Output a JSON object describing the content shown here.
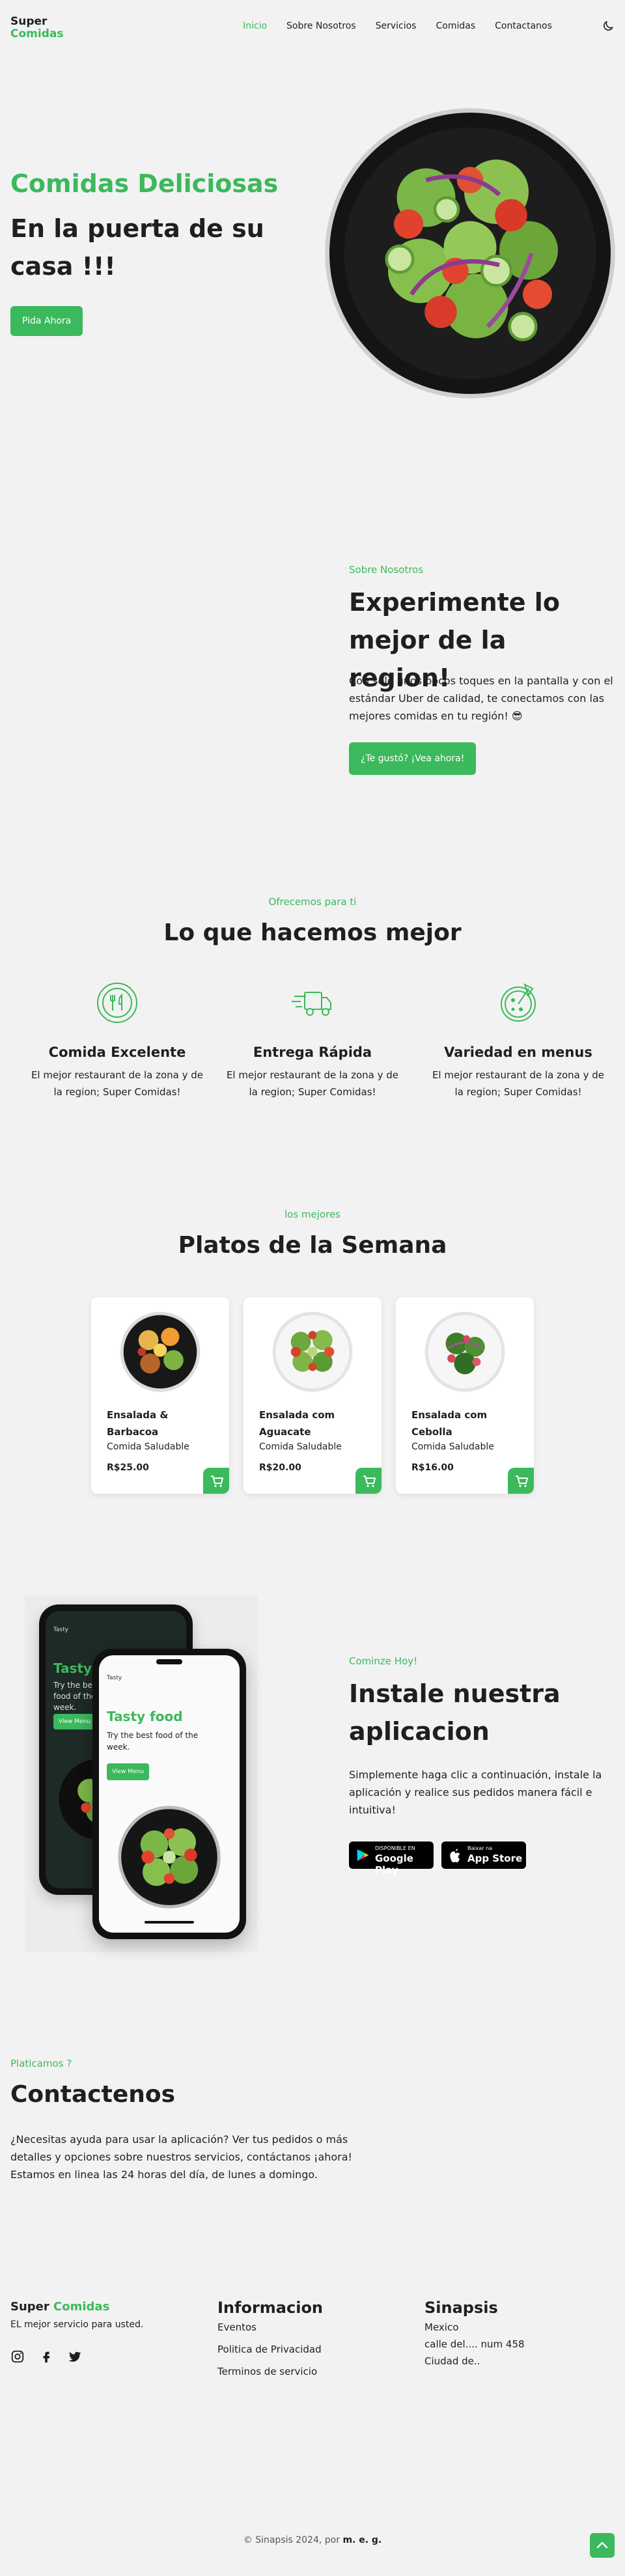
{
  "brand": {
    "line1": "Super",
    "line2": "Comidas",
    "accent": "#3bb95c"
  },
  "nav": [
    {
      "label": "Inicio",
      "active": true
    },
    {
      "label": "Sobre Nosotros"
    },
    {
      "label": "Servicios"
    },
    {
      "label": "Comidas"
    },
    {
      "label": "Contactanos"
    }
  ],
  "theme_toggle_icon": "moon-icon",
  "hero": {
    "title": "Comidas Deliciosas",
    "subtitle": "En la puerta de su casa !!!",
    "button": "Pida Ahora"
  },
  "about": {
    "eyebrow": "Sobre Nosotros",
    "title": "Experimente lo mejor de la region!",
    "text": "Con solo unos pocos toques en la pantalla y con el estándar Uber de calidad, te conectamos con las mejores comidas en tu región! 😎",
    "button": "¿Te gustó? ¡Vea ahora!"
  },
  "services": {
    "eyebrow": "Ofrecemos para ti",
    "title": "Lo que hacemos mejor",
    "items": [
      {
        "title": "Comida Excelente",
        "text": "El mejor restaurant de la zona y de la region; Super Comidas!",
        "icon": "dish-icon"
      },
      {
        "title": "Entrega Rápida",
        "text": "El mejor restaurant de la zona y de la region; Super Comidas!",
        "icon": "delivery-truck-icon"
      },
      {
        "title": "Variedad en menus",
        "text": "El mejor restaurant de la zona y de la region; Super Comidas!",
        "icon": "pizza-icon"
      }
    ]
  },
  "dishes": {
    "eyebrow": "los mejores",
    "title": "Platos de la Semana",
    "items": [
      {
        "name": "Ensalada & Barbacoa",
        "category": "Comida Saludable",
        "price": "R$25.00"
      },
      {
        "name": "Ensalada com Aguacate",
        "category": "Comida Saludable",
        "price": "R$20.00"
      },
      {
        "name": "Ensalada com Cebolla",
        "category": "Comida Saludable",
        "price": "R$16.00"
      }
    ]
  },
  "app": {
    "eyebrow": "Cominze Hoy!",
    "title": "Instale nuestra aplicacion",
    "text": "Simplemente haga clic a continuación, instale la aplicación y realice sus pedidos manera fácil e intuitiva!",
    "phone": {
      "brand": "Tasty",
      "title": "Tasty food",
      "text": "Try the best food of the week.",
      "button": "View Menu"
    },
    "stores": [
      {
        "small": "DISPONIBLE EN",
        "big": "Google Play"
      },
      {
        "small": "Baixar na",
        "big": "App Store"
      }
    ]
  },
  "contact": {
    "eyebrow": "Platicamos ?",
    "title": "Contactenos",
    "text": "¿Necesitas ayuda para usar la aplicación? Ver tus pedidos o más detalles y opciones sobre nuestros servicios, contáctanos ¡ahora! Estamos en linea las 24 horas del día, de lunes a domingo."
  },
  "footer": {
    "brand1": "Super",
    "brand2": "Comidas",
    "tagline": "EL mejor servicio para usted.",
    "social": [
      "instagram-icon",
      "facebook-icon",
      "twitter-icon"
    ],
    "info_title": "Informacion",
    "info_links": [
      "Eventos",
      "Politica de Privacidad",
      "Terminos de servicio"
    ],
    "company_title": "Sinapsis",
    "company_lines": [
      "Mexico",
      "calle del.... num 458",
      "Ciudad de.."
    ],
    "copyright_prefix": "© Sinapsis 2024, por",
    "copyright_author": "m. e. g."
  }
}
